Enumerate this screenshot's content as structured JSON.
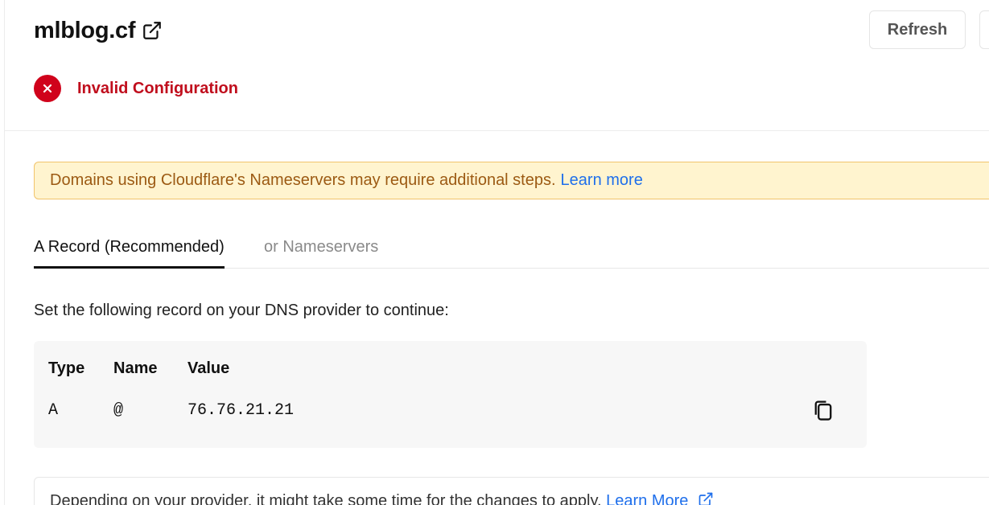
{
  "header": {
    "domain": "mlblog.cf",
    "refresh_label": "Refresh"
  },
  "status": {
    "text": "Invalid Configuration",
    "icon": "error-circle-icon"
  },
  "notice": {
    "text": "Domains using Cloudflare's Nameservers may require additional steps.",
    "link": "Learn more"
  },
  "tabs": [
    {
      "label": "A Record (Recommended)",
      "active": true
    },
    {
      "label": "or Nameservers",
      "active": false
    }
  ],
  "instruction": "Set the following record on your DNS provider to continue:",
  "record": {
    "headers": [
      "Type",
      "Name",
      "Value"
    ],
    "row": {
      "type": "A",
      "name": "@",
      "value": "76.76.21.21"
    }
  },
  "footer": {
    "text": "Depending on your provider, it might take some time for the changes to apply.",
    "link": "Learn More"
  },
  "colors": {
    "error": "#d0021b",
    "link": "#1f6feb",
    "warning_bg": "#fff4cf",
    "warning_text": "#9c5a13"
  }
}
